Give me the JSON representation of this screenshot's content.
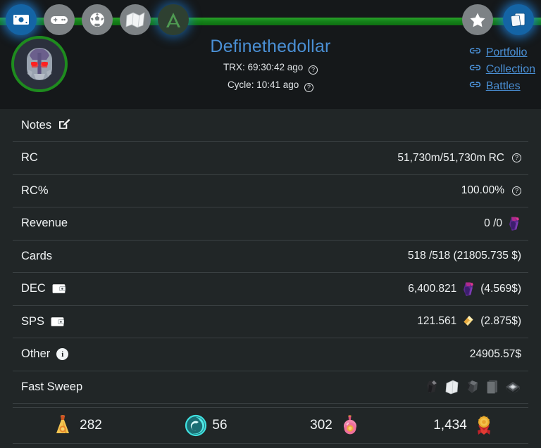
{
  "header": {
    "nav_items": [
      {
        "name": "money-icon",
        "label": "Wallet",
        "state": "active"
      },
      {
        "name": "gamepad-icon",
        "label": "Games",
        "state": "inactive"
      },
      {
        "name": "soccer-ball-icon",
        "label": "Sports",
        "state": "inactive"
      },
      {
        "name": "map-icon",
        "label": "Map",
        "state": "inactive"
      },
      {
        "name": "letter-a-icon",
        "label": "A",
        "state": "dark"
      }
    ],
    "right_nav": [
      {
        "name": "star-icon",
        "label": "Favorites",
        "state": "inactive"
      },
      {
        "name": "cards-icon",
        "label": "Cards",
        "state": "active"
      }
    ],
    "username": "Definethedollar",
    "trx_label": "TRX:",
    "trx_value": "69:30:42 ago",
    "cycle_label": "Cycle:",
    "cycle_value": "10:41 ago",
    "help_glyph": "?",
    "links": [
      {
        "label": "Portfolio",
        "icon": "link-icon"
      },
      {
        "label": "Collection",
        "icon": "link-icon"
      },
      {
        "label": "Battles",
        "icon": "link-icon"
      }
    ]
  },
  "rows": {
    "notes": {
      "label": "Notes",
      "icon": "edit-icon"
    },
    "rc": {
      "label": "RC",
      "value": "51,730m/51,730m RC"
    },
    "rc_percent": {
      "label": "RC%",
      "value": "100.00%"
    },
    "revenue": {
      "label": "Revenue",
      "value": "0 /0"
    },
    "cards": {
      "label": "Cards",
      "value": "518 /518 (21805.735 $)"
    },
    "dec": {
      "label": "DEC",
      "value": "6,400.821",
      "usd": "(4.569$)"
    },
    "sps": {
      "label": "SPS",
      "value": "121.561",
      "usd": "(2.875$)"
    },
    "other": {
      "label": "Other",
      "value": "24905.57$"
    },
    "fast_sweep": {
      "label": "Fast Sweep",
      "icons": [
        "sweep-item-1-icon",
        "sweep-item-2-icon",
        "sweep-item-3-icon",
        "sweep-item-4-icon",
        "sweep-item-5-icon"
      ]
    }
  },
  "stats": [
    {
      "icon": "gold-potion-icon",
      "value": "282",
      "order": "icon-first"
    },
    {
      "icon": "teal-vortex-icon",
      "value": "56",
      "order": "icon-first"
    },
    {
      "icon": "pink-potion-icon",
      "value": "302",
      "order": "value-first"
    },
    {
      "icon": "gold-medal-icon",
      "value": "1,434",
      "order": "value-first"
    }
  ],
  "colors": {
    "accent_blue": "#4a8fd4",
    "bar_green": "#15831a",
    "background": "#212627",
    "header_background": "#15181a",
    "divider": "#3a4042"
  }
}
